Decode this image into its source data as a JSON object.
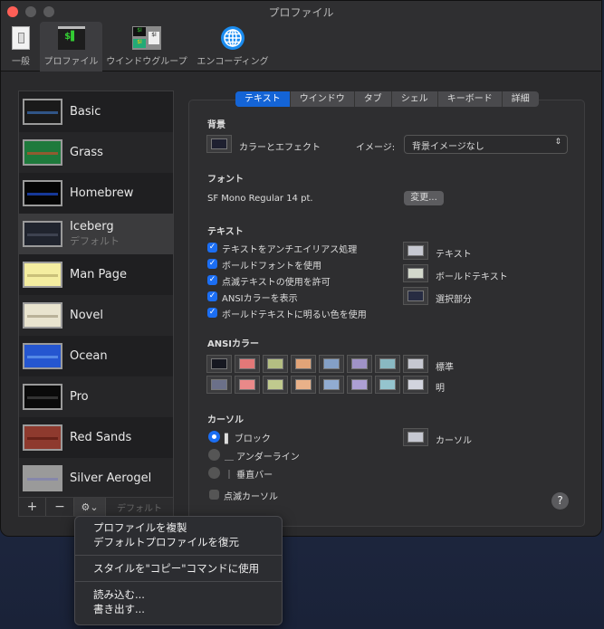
{
  "window": {
    "title": "プロファイル"
  },
  "toolbar": [
    {
      "label": "一般",
      "icon": "switch-icon"
    },
    {
      "label": "プロファイル",
      "icon": "terminal-icon",
      "selected": true
    },
    {
      "label": "ウインドウグループ",
      "icon": "window-group-icon"
    },
    {
      "label": "エンコーディング",
      "icon": "globe-icon"
    }
  ],
  "profiles": [
    {
      "name": "Basic",
      "bg": "#1a1a1a",
      "band": "#3b6fb6"
    },
    {
      "name": "Grass",
      "bg": "#1e7a3c",
      "band": "#c0502b"
    },
    {
      "name": "Homebrew",
      "bg": "#050505",
      "band": "#1e4fd8"
    },
    {
      "name": "Iceberg",
      "sub": "デフォルト",
      "bg": "#20242e",
      "band": "#4a5060",
      "selected": true
    },
    {
      "name": "Man Page",
      "bg": "#f4eda0",
      "band": "#b8ad6a"
    },
    {
      "name": "Novel",
      "bg": "#e9e4cf",
      "band": "#a59c82"
    },
    {
      "name": "Ocean",
      "bg": "#2556d0",
      "band": "#6aa0f0"
    },
    {
      "name": "Pro",
      "bg": "#0a0a0a",
      "band": "#444444"
    },
    {
      "name": "Red Sands",
      "bg": "#8e3a2e",
      "band": "#5a1a12"
    },
    {
      "name": "Silver Aerogel",
      "bg": "#9a9a9a",
      "band": "#7d7fb0"
    }
  ],
  "list_buttons": {
    "add": "+",
    "remove": "−",
    "gear": "⚙⌄",
    "default": "デフォルト"
  },
  "tabs": [
    "テキスト",
    "ウインドウ",
    "タブ",
    "シェル",
    "キーボード",
    "詳細"
  ],
  "background": {
    "heading": "背景",
    "color_effect": "カラーとエフェクト",
    "image_label": "イメージ:",
    "image_value": "背景イメージなし",
    "color": "#1e2030"
  },
  "font": {
    "heading": "フォント",
    "value": "SF Mono Regular 14 pt.",
    "change": "変更..."
  },
  "text": {
    "heading": "テキスト",
    "options": [
      {
        "label": "テキストをアンチエイリアス処理",
        "checked": true
      },
      {
        "label": "ボールドフォントを使用",
        "checked": true
      },
      {
        "label": "点滅テキストの使用を許可",
        "checked": true
      },
      {
        "label": "ANSIカラーを表示",
        "checked": true
      },
      {
        "label": "ボールドテキストに明るい色を使用",
        "checked": true
      }
    ],
    "colors": [
      {
        "label": "テキスト",
        "color": "#c6c8d1"
      },
      {
        "label": "ボールドテキスト",
        "color": "#d3d8cc"
      },
      {
        "label": "選択部分",
        "color": "#272c42"
      }
    ]
  },
  "ansi": {
    "heading": "ANSIカラー",
    "normal_label": "標準",
    "bright_label": "明",
    "normal": [
      "#161821",
      "#e27878",
      "#b4be82",
      "#e2a478",
      "#84a0c6",
      "#a093c7",
      "#89b8c2",
      "#c6c8d1"
    ],
    "bright": [
      "#6b7089",
      "#e98989",
      "#c0ca8e",
      "#e9b189",
      "#91acd1",
      "#ada0d3",
      "#95c4ce",
      "#d2d4de"
    ]
  },
  "cursor": {
    "heading": "カーソル",
    "options": [
      {
        "label": "▌ ブロック",
        "selected": true
      },
      {
        "label": "＿ アンダーライン",
        "selected": false
      },
      {
        "label": "｜ 垂直バー",
        "selected": false
      }
    ],
    "blink": "点滅カーソル",
    "blink_checked": false,
    "color_label": "カーソル",
    "color": "#c6c8d1"
  },
  "help": "?",
  "menu": [
    [
      "プロファイルを複製",
      "デフォルトプロファイルを復元"
    ],
    [
      "スタイルを\"コピー\"コマンドに使用"
    ],
    [
      "読み込む...",
      "書き出す..."
    ]
  ]
}
